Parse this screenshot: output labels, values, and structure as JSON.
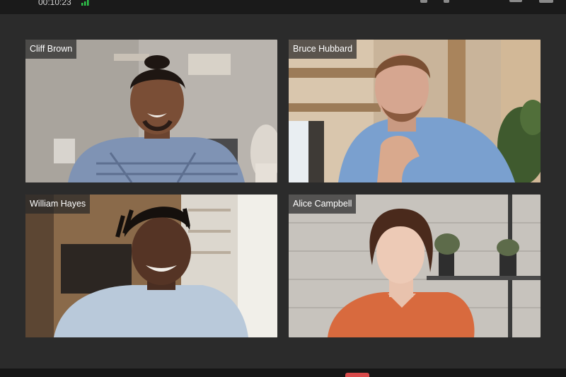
{
  "call": {
    "timer": "00:10:23",
    "signal_icon": "signal-bars-icon"
  },
  "participants": [
    {
      "name": "Cliff Brown"
    },
    {
      "name": "Bruce Hubbard"
    },
    {
      "name": "William Hayes"
    },
    {
      "name": "Alice Campbell"
    }
  ],
  "colors": {
    "background": "#2b2b2b",
    "top_bar": "#1a1a1a",
    "bottom_bar": "#161616",
    "end_call": "#d84a4a",
    "signal": "#2ec44a"
  }
}
